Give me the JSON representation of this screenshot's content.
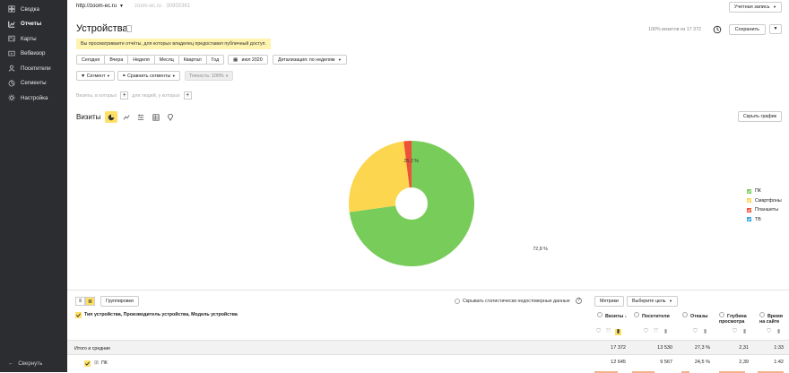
{
  "sidebar": {
    "items": [
      {
        "label": "Сводка",
        "icon": "home-icon",
        "active": false
      },
      {
        "label": "Отчеты",
        "icon": "reports-icon",
        "active": true
      },
      {
        "label": "Карты",
        "icon": "map-icon",
        "active": false
      },
      {
        "label": "Вебвизор",
        "icon": "webvisor-icon",
        "active": false
      },
      {
        "label": "Посетители",
        "icon": "visitors-icon",
        "active": false
      },
      {
        "label": "Сегменты",
        "icon": "segments-icon",
        "active": false
      },
      {
        "label": "Настройка",
        "icon": "settings-icon",
        "active": false
      }
    ],
    "collapse_label": "Свернуть"
  },
  "header": {
    "site_url": "http://zoom-ec.ru",
    "site_sub": "zoom-ec.ru · 30955361",
    "account_label": "Учетная запись",
    "title": "Устройства",
    "visits_total": "100% визитов из 17 372",
    "save_label": "Сохранить"
  },
  "notice": "Вы просматриваете отчёты, для которых владелец предоставил публичный доступ.",
  "period": {
    "buttons": [
      "Сегодня",
      "Вчера",
      "Неделя",
      "Месяц",
      "Квартал",
      "Год"
    ],
    "date_label": "июл 2020",
    "detail_label": "Детализация: по неделям"
  },
  "segment": {
    "segment_label": "Сегмент",
    "compare_label": "Сравнить сегменты",
    "accuracy_label": "Точность: 100%"
  },
  "filters": {
    "visits_where": "Визиты, в которых",
    "for_people": "для людей, у которых"
  },
  "chart": {
    "heading": "Визиты",
    "hide_label": "Скрыть график"
  },
  "chart_data": {
    "type": "pie",
    "categories": [
      "ПК",
      "Смартфоны",
      "Планшеты",
      "ТВ"
    ],
    "values": [
      72.8,
      25.2,
      2.0,
      0.0
    ],
    "colors": [
      "#78cc5a",
      "#fbd64e",
      "#ef5138",
      "#34a6d9"
    ],
    "labels": [
      "72,8 %",
      "25,2 %",
      "",
      ""
    ],
    "donut": true,
    "legend": "right"
  },
  "table": {
    "view_toggles": [
      "list-view-icon",
      "tree-view-icon"
    ],
    "group_label": "Группировки",
    "hide_unreliable_label": "Скрывать статистически недостоверные данные",
    "metrics_label": "Метрики",
    "goal_label": "Выберите цель",
    "dimension_header": "Тип устройства, Производитель устройства, Модель устройства",
    "columns": [
      {
        "label": "Визиты",
        "sort": "↓"
      },
      {
        "label": "Посетители",
        "sort": ""
      },
      {
        "label": "Отказы",
        "sort": ""
      },
      {
        "label": "Глубина просмотра",
        "sort": ""
      },
      {
        "label": "Время на сайте",
        "sort": ""
      }
    ],
    "total_row": {
      "label": "Итого и средние",
      "values": [
        "17 372",
        "13 530",
        "27,3 %",
        "2,31",
        "1:33"
      ]
    },
    "rows": [
      {
        "label": "ПК",
        "values": [
          "12 645",
          "9 567",
          "24,5 %",
          "2,39",
          "1:42"
        ],
        "bars": [
          0.728,
          0.707,
          0.245,
          0.8,
          0.9
        ]
      }
    ]
  }
}
